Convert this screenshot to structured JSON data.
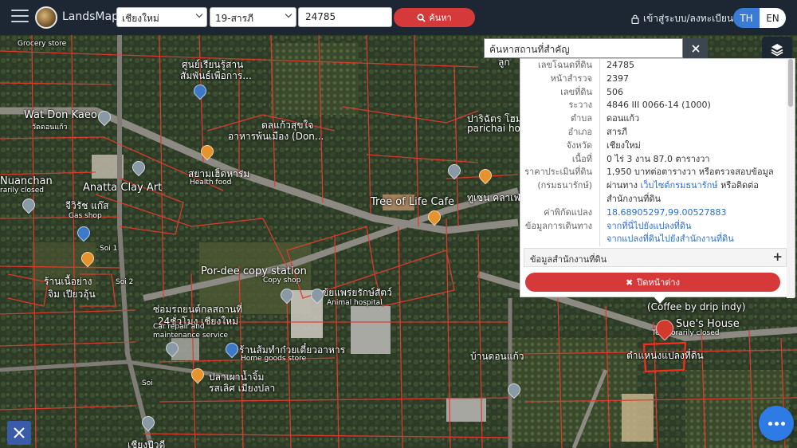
{
  "header": {
    "brand": "LandsMaps",
    "province": "เชียงใหม่",
    "district": "19-สารภี",
    "parcel_no": "24785",
    "search_label": "ค้นหา",
    "login_label": "เข้าสู่ระบบ/ลงทะเบียน",
    "lang_th": "TH",
    "lang_en": "EN"
  },
  "place_search": {
    "placeholder": "ค้นหาสถานที่สำคัญ"
  },
  "info": {
    "rows": [
      {
        "label": "เลขโฉนดที่ดิน",
        "value": "24785"
      },
      {
        "label": "หน้าสำรวจ",
        "value": "2397"
      },
      {
        "label": "เลขที่ดิน",
        "value": "506"
      },
      {
        "label": "ระวาง",
        "value": "4846 III 0066-14 (1000)"
      },
      {
        "label": "ตำบล",
        "value": "ดอนแก้ว"
      },
      {
        "label": "อำเภอ",
        "value": "สารภี"
      },
      {
        "label": "จังหวัด",
        "value": "เชียงใหม่"
      },
      {
        "label": "เนื้อที่",
        "value": "0 ไร่ 3 งาน 87.0 ตารางวา"
      }
    ],
    "price_label": "ราคาประเมินที่ดิน",
    "price_label2": "(กรมธนารักษ์)",
    "price_value": "1,950 บาทต่อตารางวา หรือตรวจสอบข้อมูลผ่านทาง",
    "price_link": "เว็บไซต์กรมธนารักษ์",
    "price_tail": "หรือติดต่อสำนักงานที่ดิน",
    "coord_label": "ค่าพิกัดแปลง",
    "coord_value": "18.68905297,99.00527883",
    "travel_label": "ข้อมูลการเดินทาง",
    "travel_link1": "จากที่นี่ไปยังแปลงที่ดิน",
    "travel_link2": "จากแปลงที่ดินไปยังสำนักงานที่ดิน",
    "office_header": "ข้อมูลสำนักงานที่ดิน",
    "close_label": "ปิดหน้าต่าง"
  },
  "map_labels": [
    {
      "text": "Grocery store",
      "cls": "small"
    },
    {
      "text": "ศูนย์เรียนรู้สาน",
      "cls": ""
    },
    {
      "text": "สัมพันธ์เพื่อการ...",
      "cls": ""
    },
    {
      "text": "Wat Don Kaeo",
      "cls": "big"
    },
    {
      "text": "วัดดอนแก้ว",
      "cls": "small"
    },
    {
      "text": "ดลแก้วสุขใจ",
      "cls": ""
    },
    {
      "text": "อาหารพ้นเมือง (Don...",
      "cls": ""
    },
    {
      "text": "ปาริฉัตร โฮม",
      "cls": ""
    },
    {
      "text": "parichai home",
      "cls": ""
    },
    {
      "text": "ลูก",
      "cls": ""
    },
    {
      "text": "Nuanchan",
      "cls": "big"
    },
    {
      "text": "rarily closed",
      "cls": "small"
    },
    {
      "text": "สยามเฮ็ดหาร่ม",
      "cls": ""
    },
    {
      "text": "Health food",
      "cls": "small"
    },
    {
      "text": "Anatta Clay Art",
      "cls": "big"
    },
    {
      "text": "จีวิรัช แก๊ส",
      "cls": ""
    },
    {
      "text": "Gas shop",
      "cls": "small"
    },
    {
      "text": "Tree of Life Cafe",
      "cls": "big"
    },
    {
      "text": "ทูเซน คลาเฟ่",
      "cls": ""
    },
    {
      "text": "Soi 1",
      "cls": "small"
    },
    {
      "text": "Por-dee copy station",
      "cls": "big"
    },
    {
      "text": "Copy shop",
      "cls": "small"
    },
    {
      "text": "ร้านเนื้อย่าง",
      "cls": ""
    },
    {
      "text": "จิม เปียวอุ้น",
      "cls": ""
    },
    {
      "text": "ข้ยแพร่ยรักษ์สัตว์",
      "cls": ""
    },
    {
      "text": "Animal hospital",
      "cls": "small"
    },
    {
      "text": "ซ่อมรถยนต์กลสถานที่",
      "cls": ""
    },
    {
      "text": "24ชั่วโมง เชียงใหม่",
      "cls": ""
    },
    {
      "text": "Car repair and",
      "cls": "small"
    },
    {
      "text": "maintenance service",
      "cls": "small"
    },
    {
      "text": "(Coffee by drip indy)",
      "cls": ""
    },
    {
      "text": "Sue's House",
      "cls": "big"
    },
    {
      "text": "Temporarily closed",
      "cls": "small"
    },
    {
      "text": "ตำแหน่งแปลงที่ดิน",
      "cls": ""
    },
    {
      "text": "ร้านส้มทำก๋วยเตี๋ยวอาหาร",
      "cls": ""
    },
    {
      "text": "Home goods store",
      "cls": "small"
    },
    {
      "text": "ปลาเผาน้ำจิ้ม",
      "cls": ""
    },
    {
      "text": "รสเลิศ เมียงปลา",
      "cls": ""
    },
    {
      "text": "บ้านดอนแก้ว",
      "cls": ""
    },
    {
      "text": "Soi",
      "cls": "small"
    },
    {
      "text": "เชียงปีวดี",
      "cls": ""
    },
    {
      "text": "Soi 2",
      "cls": "small"
    }
  ]
}
